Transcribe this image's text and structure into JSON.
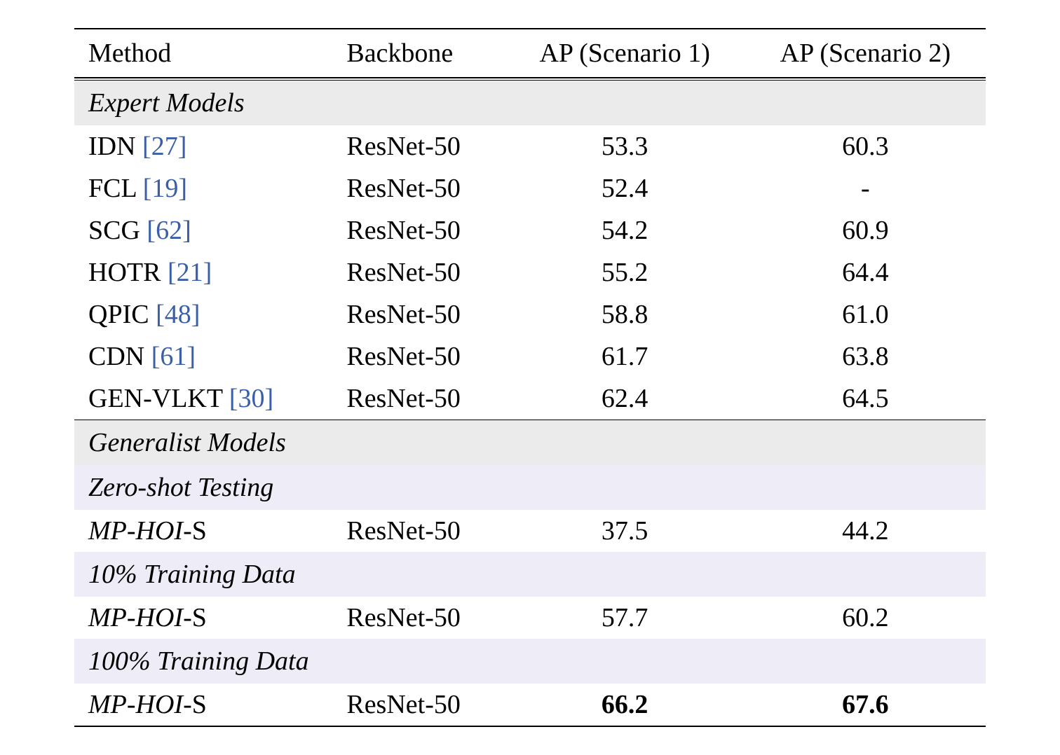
{
  "columns": {
    "method": "Method",
    "backbone": "Backbone",
    "ap1": "AP (Scenario 1)",
    "ap2": "AP (Scenario 2)"
  },
  "sections": {
    "expert": "Expert Models",
    "generalist": "Generalist Models",
    "zero_shot": "Zero-shot Testing",
    "ten_pct": "10% Training Data",
    "hundred_pct": "100% Training Data"
  },
  "rows": {
    "idn": {
      "name": "IDN",
      "cite": "[27]",
      "backbone": "ResNet-50",
      "ap1": "53.3",
      "ap2": "60.3"
    },
    "fcl": {
      "name": "FCL",
      "cite": "[19]",
      "backbone": "ResNet-50",
      "ap1": "52.4",
      "ap2": "-"
    },
    "scg": {
      "name": "SCG",
      "cite": "[62]",
      "backbone": "ResNet-50",
      "ap1": "54.2",
      "ap2": "60.9"
    },
    "hotr": {
      "name": "HOTR",
      "cite": "[21]",
      "backbone": "ResNet-50",
      "ap1": "55.2",
      "ap2": "64.4"
    },
    "qpic": {
      "name": "QPIC",
      "cite": "[48]",
      "backbone": "ResNet-50",
      "ap1": "58.8",
      "ap2": "61.0"
    },
    "cdn": {
      "name": "CDN",
      "cite": "[61]",
      "backbone": "ResNet-50",
      "ap1": "61.7",
      "ap2": "63.8"
    },
    "genvlkt": {
      "name": "GEN-VLKT",
      "cite": "[30]",
      "backbone": "ResNet-50",
      "ap1": "62.4",
      "ap2": "64.5"
    },
    "mphoi_zs": {
      "name_prefix": "MP-HOI",
      "name_suffix": "-S",
      "backbone": "ResNet-50",
      "ap1": "37.5",
      "ap2": "44.2"
    },
    "mphoi_10": {
      "name_prefix": "MP-HOI",
      "name_suffix": "-S",
      "backbone": "ResNet-50",
      "ap1": "57.7",
      "ap2": "60.2"
    },
    "mphoi_100": {
      "name_prefix": "MP-HOI",
      "name_suffix": "-S",
      "backbone": "ResNet-50",
      "ap1": "66.2",
      "ap2": "67.6"
    }
  }
}
